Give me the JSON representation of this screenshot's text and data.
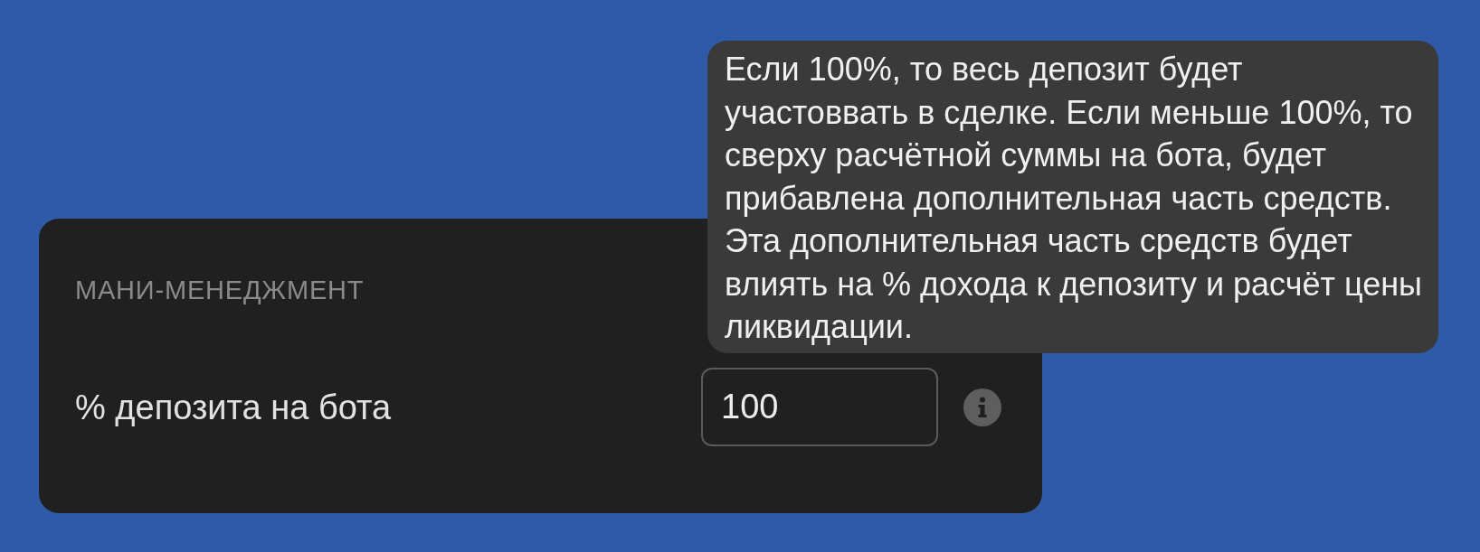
{
  "card": {
    "title": "МАНИ-МЕНЕДЖМЕНТ",
    "fields": [
      {
        "label": "% депозита на бота",
        "value": "100"
      }
    ]
  },
  "tooltip": {
    "text": "Если 100%, то весь депозит будет участоввать в сделке. Если меньше 100%, то сверху расчётной суммы на бота, будет прибавлена дополнительная часть средств. Эта дополнительная часть средств будет влиять на % дохода к депозиту и расчёт цены ликвидации."
  }
}
